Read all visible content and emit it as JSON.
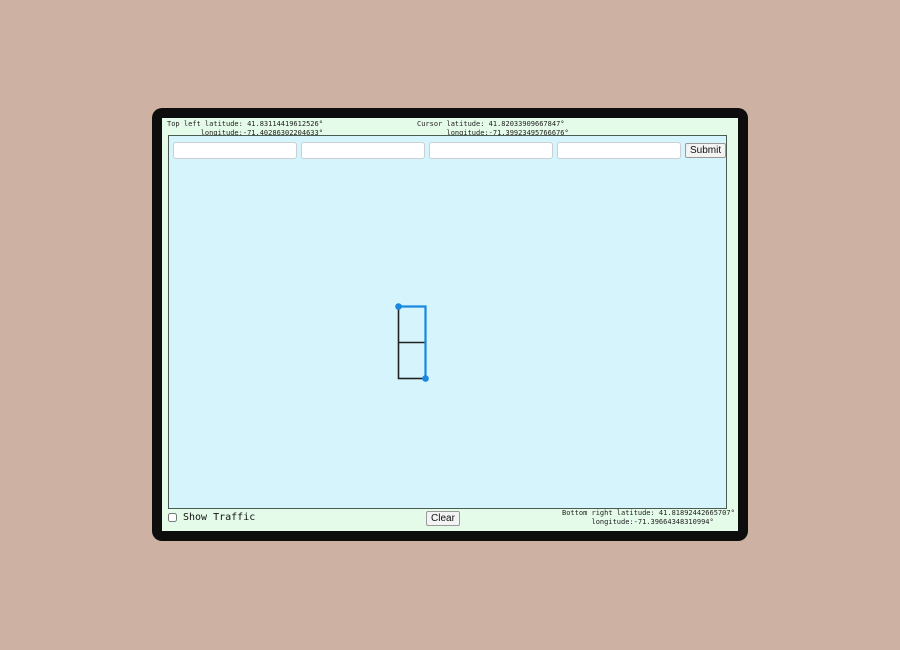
{
  "coords": {
    "top_left": "Top left latitude: 41.83114419612526°\n        longitude:-71.40286302204633°",
    "cursor": "Cursor latitude: 41.82033909667847°\n       longitude:-71.39923495766676°",
    "bottom_right": "Bottom right latitude: 41.81892442665707°\n       longitude:-71.39664348310994°"
  },
  "inputs": [
    {
      "value": "",
      "placeholder": ""
    },
    {
      "value": "",
      "placeholder": ""
    },
    {
      "value": "",
      "placeholder": ""
    },
    {
      "value": "",
      "placeholder": ""
    }
  ],
  "submit_label": "Submit",
  "show_traffic_label": "Show Traffic",
  "show_traffic_checked": false,
  "clear_label": "Clear",
  "colors": {
    "route": "#1a87e0",
    "grid_line": "#222222",
    "map_bg": "#d5f4fc",
    "panel_bg": "#e5fbe9",
    "page_bg": "#cdb2a3"
  },
  "icons": [
    "route-start-point-icon",
    "route-end-point-icon"
  ]
}
